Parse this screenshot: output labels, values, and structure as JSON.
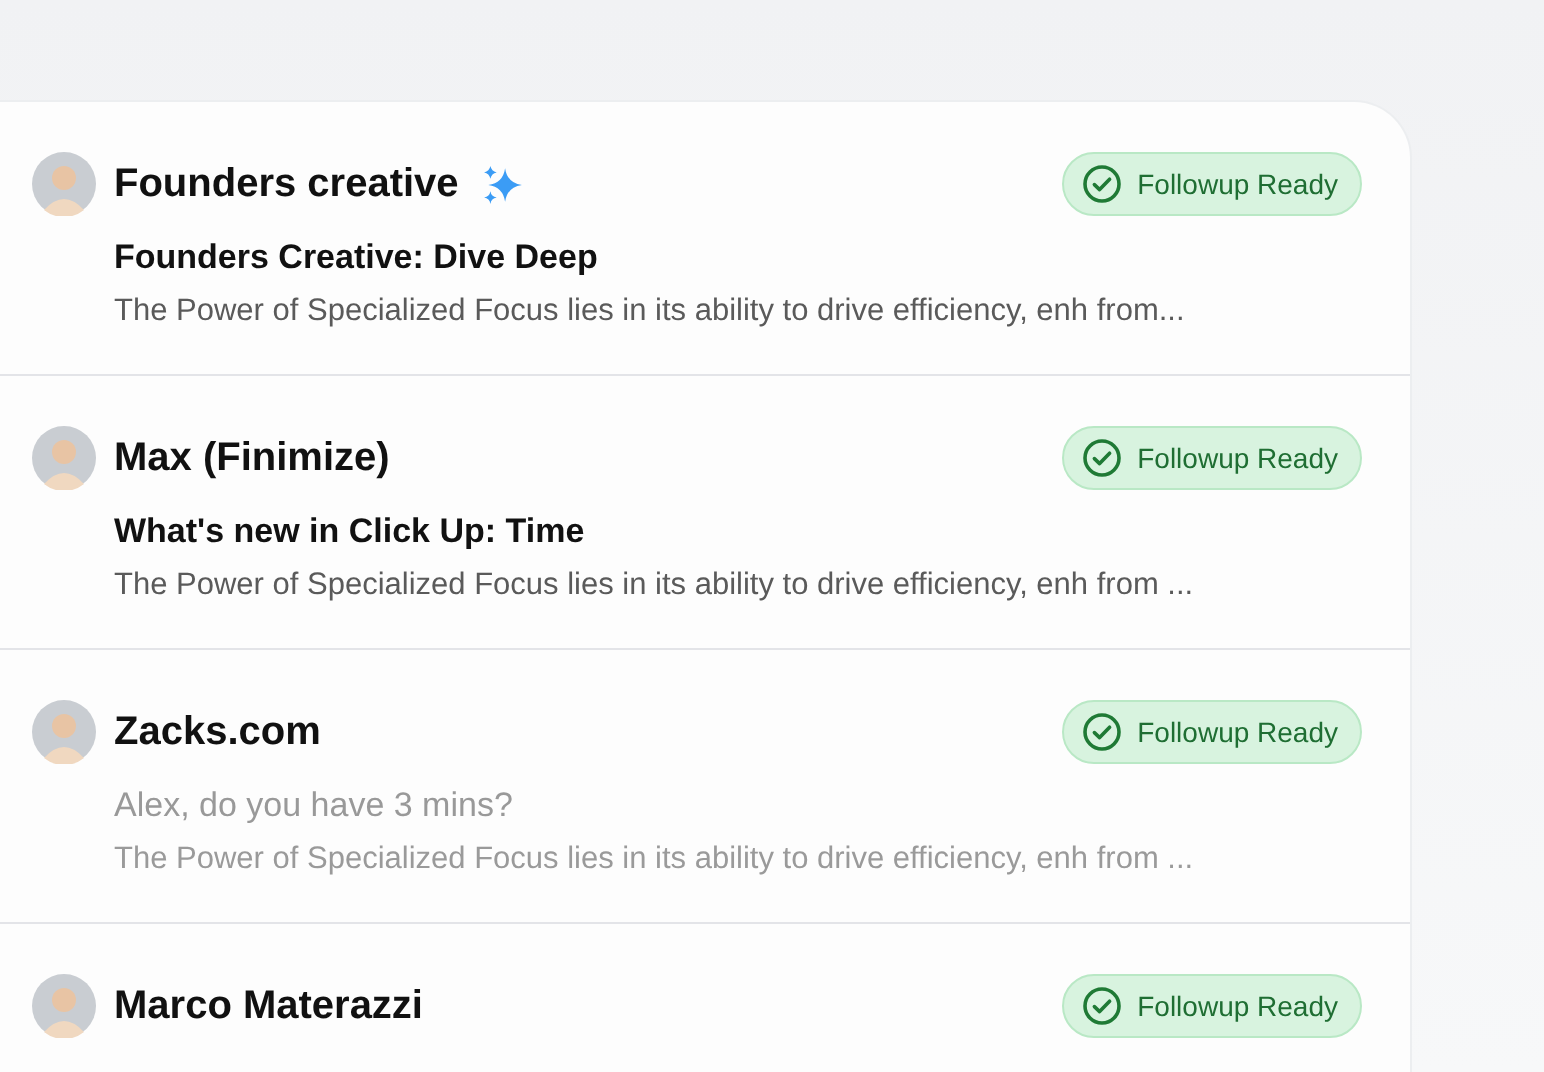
{
  "messages": [
    {
      "sender": "Founders creative",
      "sparkle": true,
      "status": "Followup Ready",
      "subject": "Founders Creative: Dive Deep",
      "preview": "The Power of Specialized Focus lies in its ability to drive efficiency, enh from...",
      "read": false
    },
    {
      "sender": "Max (Finimize)",
      "sparkle": false,
      "status": "Followup Ready",
      "subject": "What's new in Click Up: Time",
      "preview": "The Power of Specialized Focus lies in its ability to drive efficiency, enh from ...",
      "read": false
    },
    {
      "sender": "Zacks.com",
      "sparkle": false,
      "status": "Followup Ready",
      "subject": "Alex, do you have 3 mins?",
      "preview": "The Power of Specialized Focus lies in its ability to drive efficiency, enh from ...",
      "read": true
    },
    {
      "sender": "Marco Materazzi",
      "sparkle": false,
      "status": "Followup Ready"
    }
  ]
}
